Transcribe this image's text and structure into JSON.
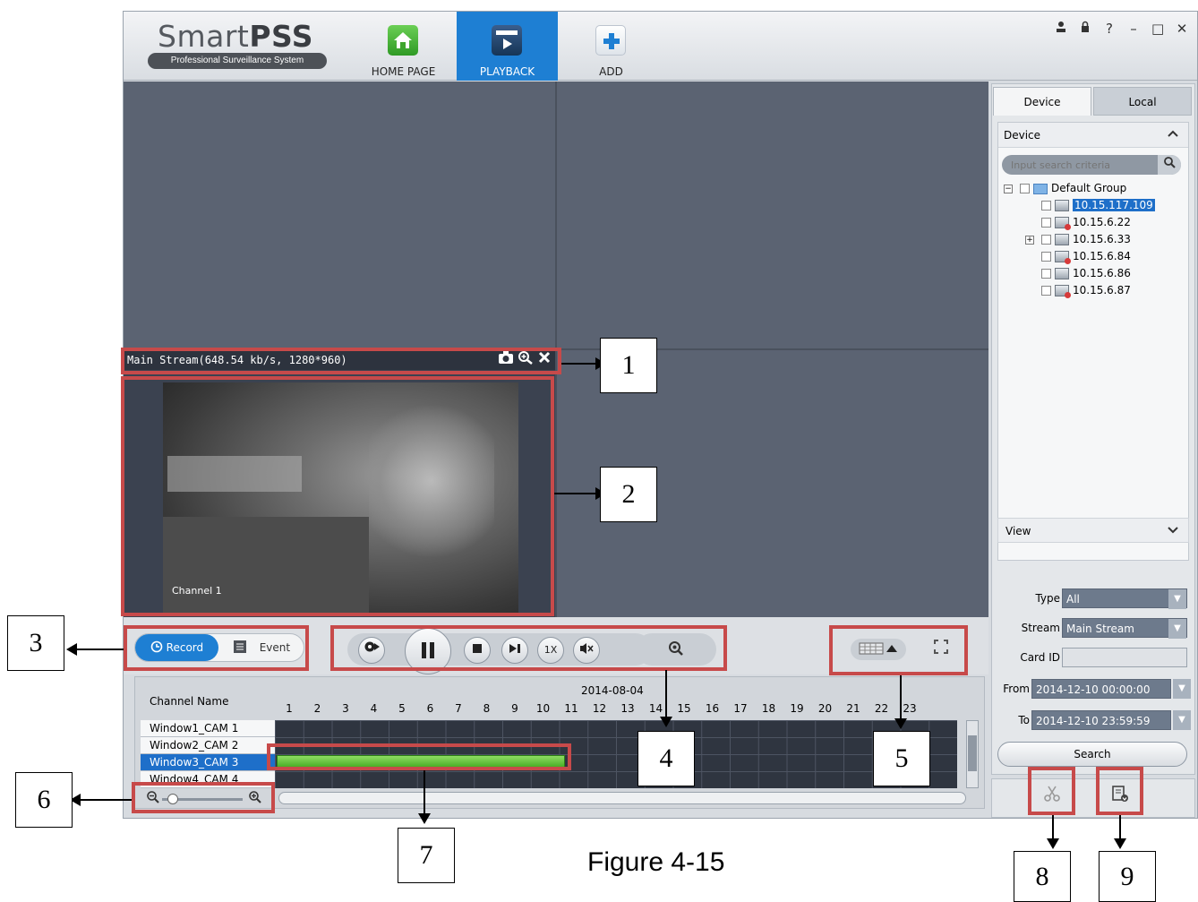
{
  "app": {
    "logo_main": "Smart",
    "logo_bold": "PSS",
    "logo_sub": "Professional Surveillance System"
  },
  "nav": {
    "home": "HOME PAGE",
    "playback": "PLAYBACK",
    "add": "ADD"
  },
  "window_controls": [
    "user-icon",
    "lock-icon",
    "help-icon",
    "minimize-icon",
    "maximize-icon",
    "close-icon"
  ],
  "window_controls_glyphs": {
    "help": "?",
    "minimize": "–",
    "maximize": "□",
    "close": "✕"
  },
  "video": {
    "stream_info": "Main Stream(648.54 kb/s, 1280*960)",
    "channel_label": "Channel 1"
  },
  "right_panel": {
    "tab_device": "Device",
    "tab_local": "Local",
    "device_header": "Device",
    "search_placeholder": "Input search criteria",
    "tree": {
      "group": "Default Group",
      "devices": [
        "10.15.117.109",
        "10.15.6.22",
        "10.15.6.33",
        "10.15.6.84",
        "10.15.6.86",
        "10.15.6.87"
      ]
    },
    "view_header": "View",
    "type_label": "Type",
    "type_value": "All",
    "stream_label": "Stream",
    "stream_value": "Main Stream",
    "card_label": "Card ID",
    "card_value": "",
    "from_label": "From",
    "from_value": "2014-12-10 00:00:00",
    "to_label": "To",
    "to_value": "2014-12-10 23:59:59",
    "search_button": "Search"
  },
  "controls": {
    "record": "Record",
    "event": "Event",
    "speed": "1X"
  },
  "timeline": {
    "date": "2014-08-04",
    "channel_header": "Channel Name",
    "hours": [
      "1",
      "2",
      "3",
      "4",
      "5",
      "6",
      "7",
      "8",
      "9",
      "10",
      "11",
      "12",
      "13",
      "14",
      "15",
      "16",
      "17",
      "18",
      "19",
      "20",
      "21",
      "22",
      "23"
    ],
    "channels": [
      "Window1_CAM 1",
      "Window2_CAM 2",
      "Window3_CAM 3",
      "Window4_CAM 4"
    ],
    "active_channel": "Window3_CAM 3"
  },
  "callouts": [
    "1",
    "2",
    "3",
    "4",
    "5",
    "6",
    "7",
    "8",
    "9"
  ],
  "caption": "Figure 4-15",
  "colors": {
    "accent": "#1e7fd3",
    "annotation": "#c74a4a",
    "record_bar": "#3ea61d",
    "video_bg": "#5b6372"
  }
}
